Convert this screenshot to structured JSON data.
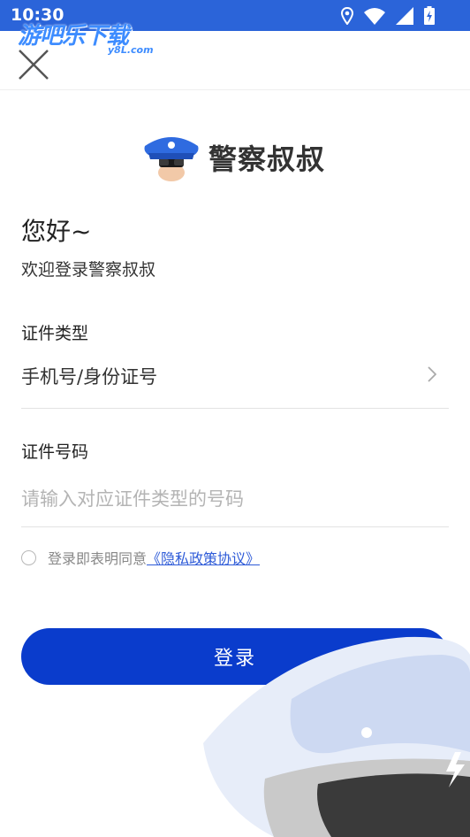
{
  "status_bar": {
    "time": "10:30",
    "icons": [
      "location-icon",
      "wifi-icon",
      "signal-icon",
      "battery-icon"
    ],
    "watermark": "游吧乐下载",
    "watermark_sub": "y8L.com"
  },
  "header": {
    "close_icon": "close-icon"
  },
  "brand": {
    "title": "警察叔叔",
    "logo_icon": "police-logo-icon"
  },
  "greeting": "您好~",
  "welcome": "欢迎登录警察叔叔",
  "id_type": {
    "label": "证件类型",
    "value": "手机号/身份证号"
  },
  "id_number": {
    "label": "证件号码",
    "placeholder": "请输入对应证件类型的号码",
    "value": ""
  },
  "agreement": {
    "text": "登录即表明同意",
    "link": "《隐私政策协议》",
    "checked": false
  },
  "login_button": "登录",
  "colors": {
    "status_bar": "#2b64d9",
    "primary": "#0a3ccc",
    "link": "#2e5bd8",
    "text": "#222222",
    "placeholder": "#b4b4b4"
  }
}
